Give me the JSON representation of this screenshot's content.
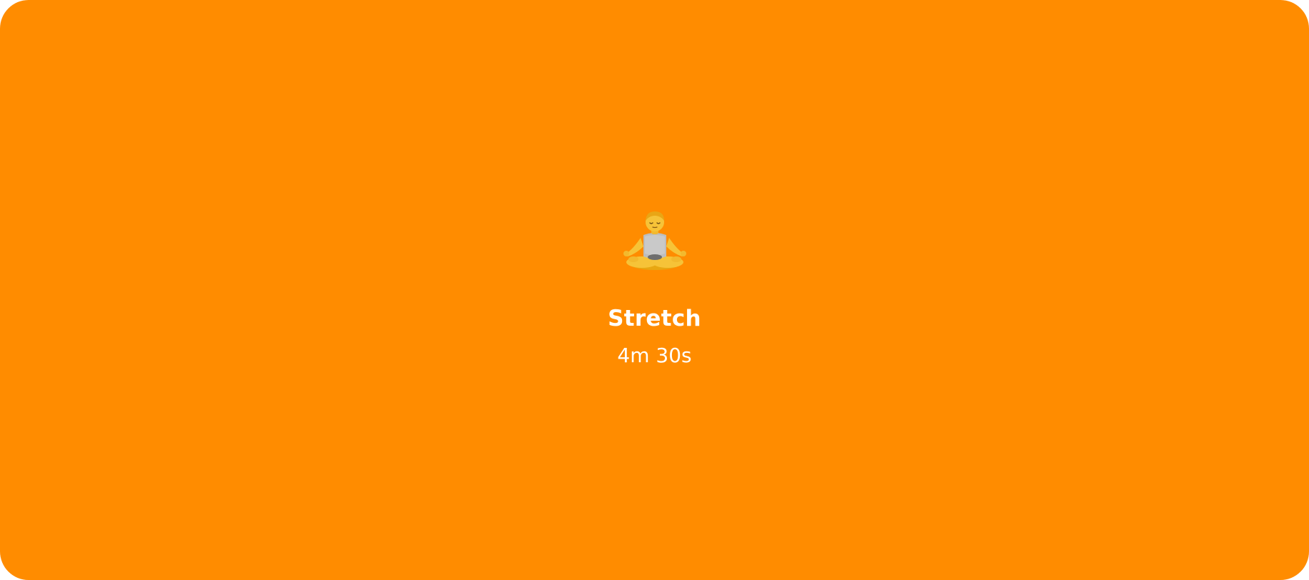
{
  "card": {
    "background_color": "#FF8C00",
    "icon": "person-in-lotus-position-icon",
    "title": "Stretch",
    "duration": "4m 30s"
  }
}
